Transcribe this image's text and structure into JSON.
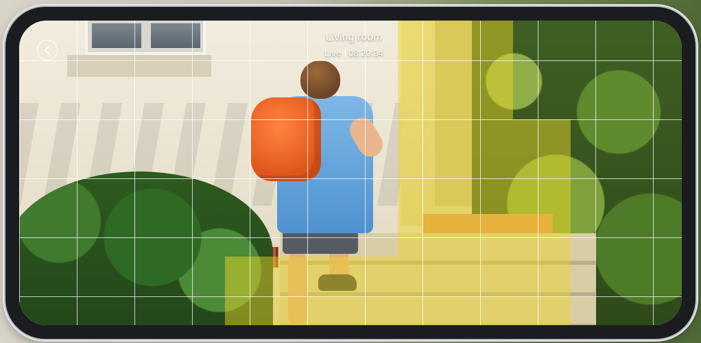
{
  "camera": {
    "title": "Living room",
    "status": "Live",
    "time": "08:20:34"
  },
  "icons": {
    "back": "chevron-left-icon"
  },
  "colors": {
    "zone_highlight": "#ecd628",
    "grid_lines": "#ffffff",
    "frame": "#1b1c1f"
  }
}
